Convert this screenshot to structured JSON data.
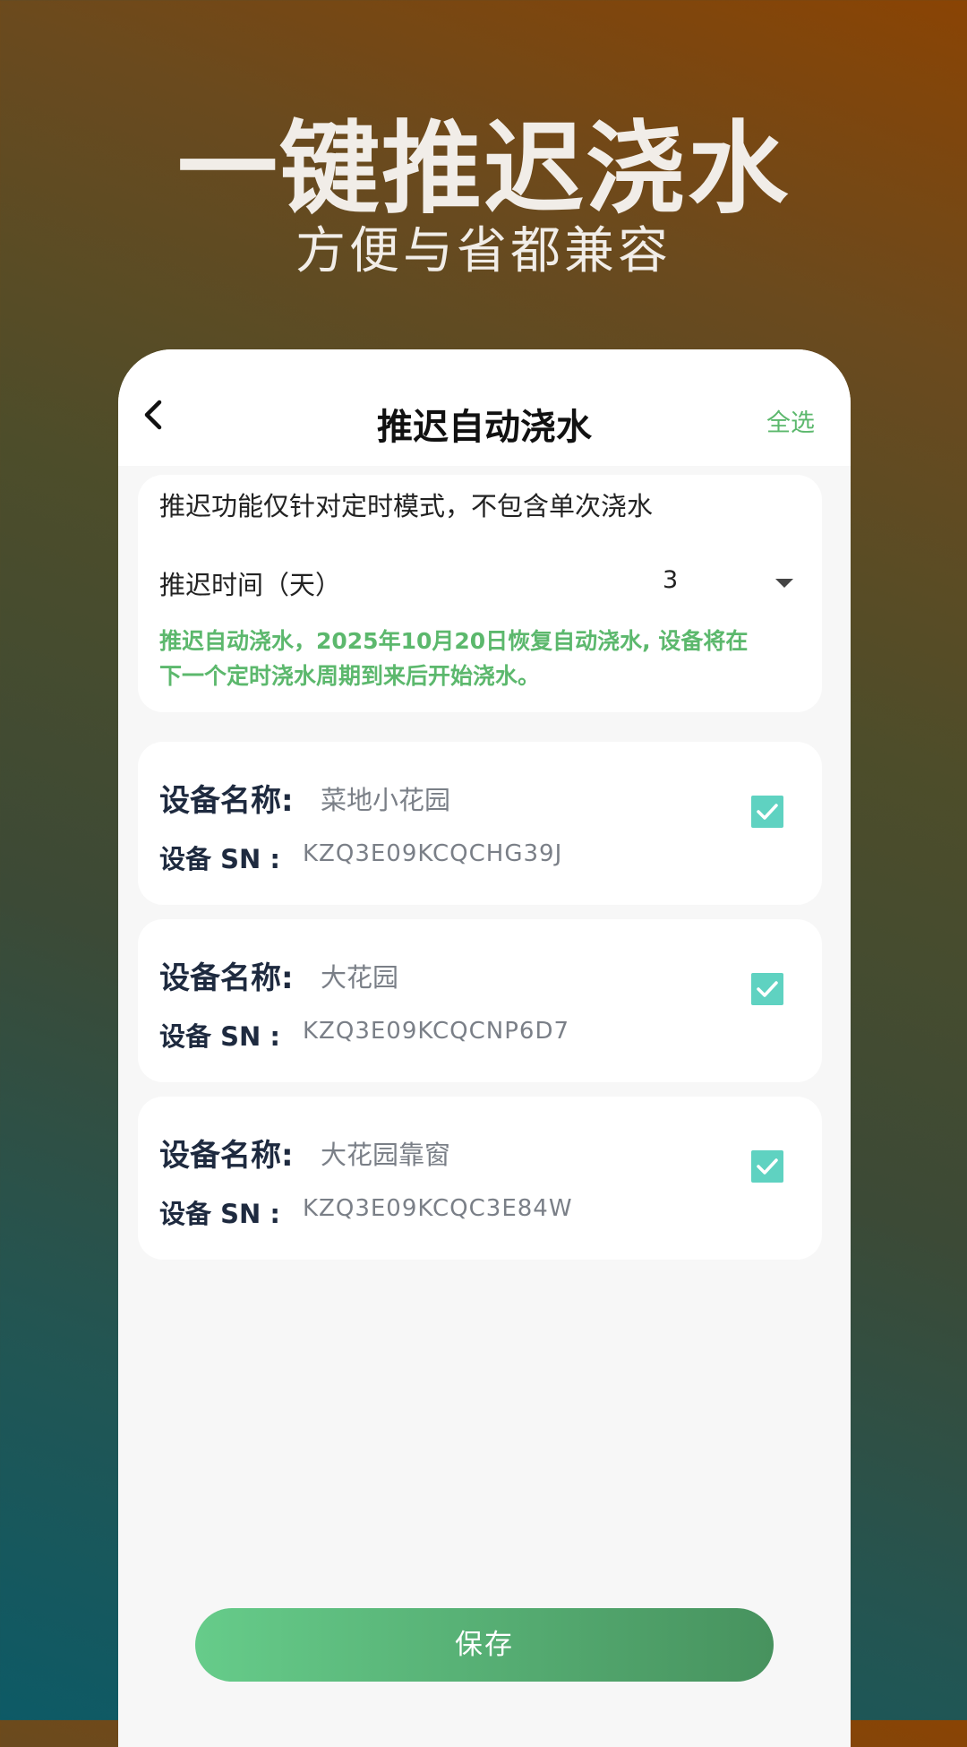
{
  "hero": {
    "title": "一键推迟浇水",
    "subtitle": "方便与省都兼容"
  },
  "nav": {
    "back_icon": "chevron-left-icon",
    "title": "推迟自动浇水",
    "select_all": "全选"
  },
  "info": {
    "description": "推迟功能仅针对定时模式，不包含单次浇水",
    "delay_label": "推迟时间（天）",
    "delay_value": "3",
    "dropdown_icon": "caret-down-icon",
    "notice_line1": "推迟自动浇水，2025年10月20日恢复自动浇水, 设备将在",
    "notice_line2": "下一个定时浇水周期到来后开始浇水。",
    "notice_color": "#5cb86d"
  },
  "devices": [
    {
      "name_label": "设备名称:",
      "name": "菜地小花园",
      "sn_label": "设备 SN :",
      "sn": "KZQ3E09KCQCHG39J",
      "checked": true
    },
    {
      "name_label": "设备名称:",
      "name": "大花园",
      "sn_label": "设备 SN :",
      "sn": "KZQ3E09KCQCNP6D7",
      "checked": true
    },
    {
      "name_label": "设备名称:",
      "name": "大花园靠窗",
      "sn_label": "设备 SN :",
      "sn": "KZQ3E09KCQC3E84W",
      "checked": true
    }
  ],
  "save_button": "保存",
  "colors": {
    "accent_green": "#5cb86d",
    "checkbox": "#5fd2c1",
    "save_gradient_start": "#66cc8a",
    "save_gradient_end": "#47925e"
  }
}
